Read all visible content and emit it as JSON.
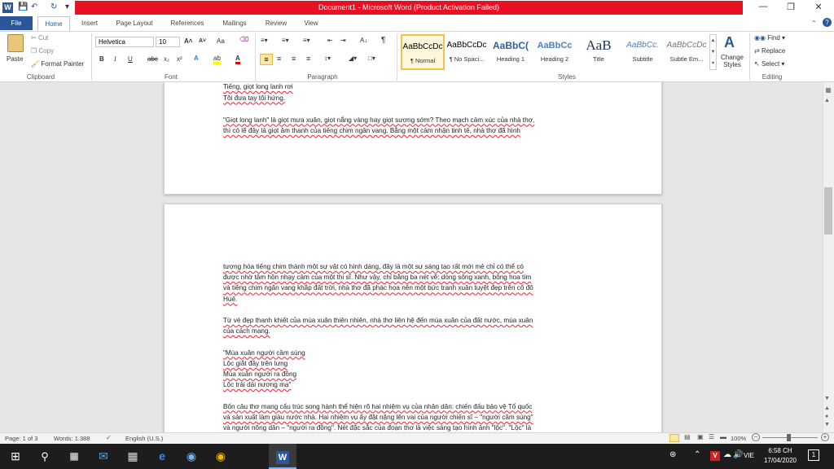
{
  "window": {
    "title": "Document1 - Microsoft Word (Product Activation Failed)",
    "quick_access": [
      "save-icon",
      "undo-icon",
      "redo-icon"
    ],
    "controls": [
      "—",
      "❐",
      "✕"
    ]
  },
  "tabs": [
    "File",
    "Home",
    "Insert",
    "Page Layout",
    "References",
    "Mailings",
    "Review",
    "View"
  ],
  "ribbon": {
    "clipboard": {
      "paste": "Paste",
      "cut": "Cut",
      "copy": "Copy",
      "format_painter": "Format Painter",
      "label": "Clipboard"
    },
    "font": {
      "name": "Helvetica",
      "size": "10",
      "label": "Font",
      "bold": "B",
      "italic": "I",
      "underline": "U",
      "strike": "abc",
      "sub": "x₂",
      "sup": "x²",
      "grow": "A˄",
      "shrink": "A˅",
      "case": "Aa",
      "color_a": "A"
    },
    "paragraph": {
      "label": "Paragraph",
      "pilcrow": "¶"
    },
    "styles": {
      "label": "Styles",
      "items": [
        {
          "preview": "AaBbCcDc",
          "name": "¶ Normal"
        },
        {
          "preview": "AaBbCcDc",
          "name": "¶ No Spaci..."
        },
        {
          "preview": "AaBbC(",
          "name": "Heading 1"
        },
        {
          "preview": "AaBbCc",
          "name": "Heading 2"
        },
        {
          "preview": "AaB",
          "name": "Title"
        },
        {
          "preview": "AaBbCc.",
          "name": "Subtitle"
        },
        {
          "preview": "AaBbCcDc",
          "name": "Subtle Em..."
        }
      ],
      "change": "Change Styles"
    },
    "editing": {
      "label": "Editing",
      "find": "Find",
      "replace": "Replace",
      "select": "Select"
    }
  },
  "document": {
    "page1_lines": [
      "Tiếng, giọt long lanh rơi",
      "Tôi đưa tay tôi hứng.",
      "",
      "\"Giọt long lanh\" là giọt mưa xuân, giọt nắng vàng hay giọt sương sớm? Theo mạch cảm xúc của nhà thơ,",
      "thì có lẽ đây là giọt âm thanh của tiếng chim ngân vang. Bằng một cảm nhận tinh tế, nhà thơ đã hình"
    ],
    "page2_lines": [
      "tượng hóa tiếng chim thành một sự vật có hình dáng, đây là một sự sáng tạo rất mới mẻ chỉ có thể có",
      "được nhờ tâm hồn nhạy cảm của một thi sĩ. Như vậy, chỉ bằng ba nét vẽ: dòng sông xanh, bông hoa tím",
      "và tiếng chim ngân vang khắp đất trời, nhà thơ đã phác họa nên một bức tranh xuân tuyệt đẹp trên cố đô",
      "Huế.",
      "",
      "Từ vẻ đẹp thanh khiết của mùa xuân thiên nhiên, nhà thơ liên hệ đến mùa xuân của đất nước, mùa xuân",
      "của cách mạng.",
      "",
      "\"Mùa xuân người cầm súng",
      "Lộc giắt đầy trên lưng",
      "Mùa xuân người ra đồng",
      "Lộc trải dài nương mạ\"",
      "",
      "Bốn câu thơ mang cấu trúc song hành thể hiện rõ hai nhiệm vụ của nhân dân: chiến đấu bảo vệ Tổ quốc",
      "và sản xuất làm giàu nước nhà. Hai nhiệm vụ ấy đặt nặng lên vai của người chiến sĩ – \"người cầm súng\"",
      "và người nông dân – \"người ra đồng\". Nét đặc sắc của đoạn thơ là việc sáng tạo hình ảnh \"lộc\". \"Lộc\" là"
    ]
  },
  "status": {
    "page": "Page: 1 of 3",
    "words": "Words: 1.388",
    "language": "English (U.S.)",
    "zoom": "100%"
  },
  "taskbar": {
    "lang": "VIE",
    "time": "6:58 CH",
    "date": "17/04/2020",
    "notifications": "1"
  }
}
